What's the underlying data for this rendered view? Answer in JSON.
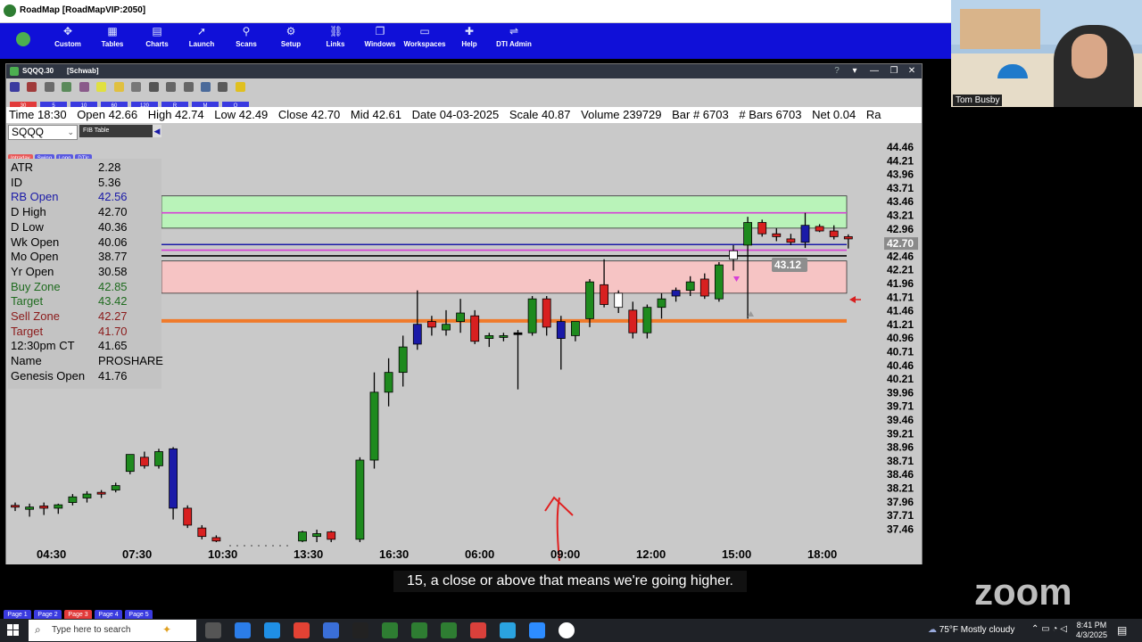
{
  "app": {
    "title": "RoadMap [RoadMapVIP:2050]"
  },
  "ribbon": {
    "items": [
      {
        "label": "Custom",
        "icon": "custom-icon"
      },
      {
        "label": "Tables",
        "icon": "tables-icon"
      },
      {
        "label": "Charts",
        "icon": "charts-icon"
      },
      {
        "label": "Launch",
        "icon": "launch-icon"
      },
      {
        "label": "Scans",
        "icon": "scans-icon"
      },
      {
        "label": "Setup",
        "icon": "gear-icon"
      },
      {
        "label": "Links",
        "icon": "links-icon"
      },
      {
        "label": "Windows",
        "icon": "windows-icon"
      },
      {
        "label": "Workspaces",
        "icon": "workspaces-icon"
      },
      {
        "label": "Help",
        "icon": "help-icon"
      },
      {
        "label": "DTI Admin",
        "icon": "admin-icon"
      }
    ]
  },
  "chart_window": {
    "title_symbol": "SQQQ.30",
    "title_source": "[Schwab]",
    "intervals": [
      {
        "label": "30",
        "active": true
      },
      {
        "label": "5",
        "active": false
      },
      {
        "label": "10",
        "active": false
      },
      {
        "label": "60",
        "active": false
      },
      {
        "label": "120",
        "active": false
      },
      {
        "label": "R",
        "active": false
      },
      {
        "label": "M",
        "active": false
      },
      {
        "label": "Q",
        "active": false
      }
    ],
    "info_bar": {
      "time": "Time 18:30",
      "open": "Open 42.66",
      "high": "High 42.74",
      "low": "Low 42.49",
      "close": "Close 42.70",
      "mid": "Mid 42.61",
      "date": "Date 04-03-2025",
      "scale": "Scale 40.87",
      "volume": "Volume 239729",
      "bar": "Bar # 6703",
      "bars": "# Bars 6703",
      "net": "Net 0.04",
      "range": "Ra"
    },
    "symbol_input": "SQQQ",
    "options": "FIB  Table",
    "panel_tabs": [
      {
        "label": "Intraday",
        "active": true
      },
      {
        "label": "Swing",
        "active": false
      },
      {
        "label": "Long",
        "active": false
      },
      {
        "label": "DTIc",
        "active": false
      }
    ],
    "stats": [
      {
        "key": "ATR",
        "value": "2.28",
        "color": "#000000"
      },
      {
        "key": "ID",
        "value": "5.36",
        "color": "#000000"
      },
      {
        "key": "RB Open",
        "value": "42.56",
        "color": "#1a1aa8"
      },
      {
        "key": "D High",
        "value": "42.70",
        "color": "#000000"
      },
      {
        "key": "D Low",
        "value": "40.36",
        "color": "#000000"
      },
      {
        "key": "Wk Open",
        "value": "40.06",
        "color": "#000000"
      },
      {
        "key": "Mo Open",
        "value": "38.77",
        "color": "#000000"
      },
      {
        "key": "Yr Open",
        "value": "30.58",
        "color": "#000000"
      },
      {
        "key": "Buy Zone",
        "value": "42.85",
        "color": "#1f6b1f"
      },
      {
        "key": "Target",
        "value": "43.42",
        "color": "#1f6b1f"
      },
      {
        "key": "Sell Zone",
        "value": "42.27",
        "color": "#8b1a1a"
      },
      {
        "key": "Target",
        "value": "41.70",
        "color": "#8b1a1a"
      },
      {
        "key": "12:30pm CT",
        "value": "41.65",
        "color": "#000000"
      },
      {
        "key": "Name",
        "value": "PROSHARE",
        "color": "#000000"
      },
      {
        "key": "Genesis Open",
        "value": "41.76",
        "color": "#000000"
      }
    ]
  },
  "chart_data": {
    "type": "candlestick",
    "symbol": "SQQQ",
    "interval": "30",
    "y_ticks": [
      "44.46",
      "44.21",
      "43.96",
      "43.71",
      "43.46",
      "43.21",
      "42.96",
      "42.70",
      "42.46",
      "42.21",
      "41.96",
      "41.71",
      "41.46",
      "41.21",
      "40.96",
      "40.71",
      "40.46",
      "40.21",
      "39.96",
      "39.71",
      "39.46",
      "39.21",
      "38.96",
      "38.71",
      "38.46",
      "38.21",
      "37.96",
      "37.71",
      "37.46"
    ],
    "x_ticks": [
      "04:30",
      "07:30",
      "10:30",
      "13:30",
      "16:30",
      "06:00",
      "09:00",
      "12:00",
      "15:00",
      "18:00"
    ],
    "ylim": [
      37.3,
      44.55
    ],
    "current_price": "42.70",
    "marker_label": "43.12",
    "zones": [
      {
        "name": "Buy Zone",
        "low": 42.85,
        "high": 43.42,
        "color": "#b9f3b9"
      },
      {
        "name": "Sell Zone",
        "low": 41.7,
        "high": 42.27,
        "color": "#f6c4c4"
      }
    ],
    "levels": [
      {
        "value": 43.12,
        "color": "#d63fd6"
      },
      {
        "value": 42.56,
        "color": "#1a1aa8"
      },
      {
        "value": 42.46,
        "color": "#d63fd6"
      },
      {
        "value": 42.36,
        "color": "#000000"
      },
      {
        "value": 41.21,
        "color": "#f07a2a"
      }
    ],
    "candles": [
      {
        "x": 0,
        "o": 37.92,
        "h": 38.0,
        "l": 37.85,
        "c": 37.95,
        "color": "red"
      },
      {
        "x": 1,
        "o": 37.88,
        "h": 37.98,
        "l": 37.75,
        "c": 37.92,
        "color": "green"
      },
      {
        "x": 2,
        "o": 37.9,
        "h": 38.0,
        "l": 37.78,
        "c": 37.94,
        "color": "red"
      },
      {
        "x": 3,
        "o": 37.9,
        "h": 37.98,
        "l": 37.8,
        "c": 37.96,
        "color": "green"
      },
      {
        "x": 4,
        "o": 38.0,
        "h": 38.15,
        "l": 37.95,
        "c": 38.1,
        "color": "green"
      },
      {
        "x": 5,
        "o": 38.08,
        "h": 38.2,
        "l": 38.0,
        "c": 38.15,
        "color": "green"
      },
      {
        "x": 6,
        "o": 38.15,
        "h": 38.22,
        "l": 38.08,
        "c": 38.18,
        "color": "red"
      },
      {
        "x": 7,
        "o": 38.22,
        "h": 38.35,
        "l": 38.18,
        "c": 38.3,
        "color": "green"
      },
      {
        "x": 8,
        "o": 38.55,
        "h": 38.85,
        "l": 38.5,
        "c": 38.85,
        "color": "green"
      },
      {
        "x": 9,
        "o": 38.8,
        "h": 38.9,
        "l": 38.6,
        "c": 38.65,
        "color": "red"
      },
      {
        "x": 10,
        "o": 38.65,
        "h": 38.95,
        "l": 38.6,
        "c": 38.9,
        "color": "green"
      },
      {
        "x": 11,
        "o": 38.95,
        "h": 38.98,
        "l": 37.7,
        "c": 37.9,
        "color": "blue"
      },
      {
        "x": 12,
        "o": 37.9,
        "h": 37.95,
        "l": 37.55,
        "c": 37.6,
        "color": "red"
      },
      {
        "x": 13,
        "o": 37.55,
        "h": 37.6,
        "l": 37.35,
        "c": 37.4,
        "color": "red"
      },
      {
        "x": 14,
        "o": 37.38,
        "h": 37.42,
        "l": 37.3,
        "c": 37.32,
        "color": "red"
      },
      {
        "x": 20,
        "o": 37.32,
        "h": 37.5,
        "l": 37.3,
        "c": 37.48,
        "color": "green"
      },
      {
        "x": 21,
        "o": 37.4,
        "h": 37.52,
        "l": 37.3,
        "c": 37.45,
        "color": "green"
      },
      {
        "x": 22,
        "o": 37.48,
        "h": 37.5,
        "l": 37.3,
        "c": 37.35,
        "color": "red"
      },
      {
        "x": 24,
        "o": 37.35,
        "h": 38.8,
        "l": 37.3,
        "c": 38.75,
        "color": "green"
      },
      {
        "x": 25,
        "o": 38.75,
        "h": 40.3,
        "l": 38.6,
        "c": 39.95,
        "color": "green"
      },
      {
        "x": 26,
        "o": 39.95,
        "h": 40.55,
        "l": 39.7,
        "c": 40.3,
        "color": "green"
      },
      {
        "x": 27,
        "o": 40.3,
        "h": 40.95,
        "l": 40.05,
        "c": 40.75,
        "color": "green"
      },
      {
        "x": 28,
        "o": 40.8,
        "h": 41.75,
        "l": 40.7,
        "c": 41.15,
        "color": "blue"
      },
      {
        "x": 29,
        "o": 41.1,
        "h": 41.3,
        "l": 40.95,
        "c": 41.2,
        "color": "red"
      },
      {
        "x": 30,
        "o": 41.05,
        "h": 41.4,
        "l": 40.95,
        "c": 41.15,
        "color": "green"
      },
      {
        "x": 31,
        "o": 41.2,
        "h": 41.6,
        "l": 41.0,
        "c": 41.35,
        "color": "green"
      },
      {
        "x": 32,
        "o": 41.3,
        "h": 41.4,
        "l": 40.8,
        "c": 40.85,
        "color": "red"
      },
      {
        "x": 33,
        "o": 40.9,
        "h": 41.0,
        "l": 40.75,
        "c": 40.95,
        "color": "green"
      },
      {
        "x": 34,
        "o": 40.93,
        "h": 41.0,
        "l": 40.85,
        "c": 40.95,
        "color": "green"
      },
      {
        "x": 35,
        "o": 41.0,
        "h": 41.05,
        "l": 40.0,
        "c": 41.0,
        "color": "black"
      },
      {
        "x": 36,
        "o": 41.0,
        "h": 41.65,
        "l": 40.95,
        "c": 41.6,
        "color": "green"
      },
      {
        "x": 37,
        "o": 41.6,
        "h": 41.65,
        "l": 40.95,
        "c": 41.1,
        "color": "red"
      },
      {
        "x": 38,
        "o": 40.9,
        "h": 41.3,
        "l": 40.35,
        "c": 41.2,
        "color": "blue"
      },
      {
        "x": 39,
        "o": 40.95,
        "h": 41.2,
        "l": 40.85,
        "c": 41.2,
        "color": "green"
      },
      {
        "x": 40,
        "o": 41.25,
        "h": 41.95,
        "l": 41.1,
        "c": 41.9,
        "color": "green"
      },
      {
        "x": 41,
        "o": 41.85,
        "h": 42.3,
        "l": 41.45,
        "c": 41.5,
        "color": "red"
      },
      {
        "x": 42,
        "o": 41.45,
        "h": 41.75,
        "l": 41.35,
        "c": 41.7,
        "color": "white"
      },
      {
        "x": 43,
        "o": 41.4,
        "h": 41.55,
        "l": 40.9,
        "c": 41.0,
        "color": "red"
      },
      {
        "x": 44,
        "o": 41.0,
        "h": 41.5,
        "l": 40.9,
        "c": 41.45,
        "color": "green"
      },
      {
        "x": 45,
        "o": 41.45,
        "h": 41.7,
        "l": 41.25,
        "c": 41.6,
        "color": "green"
      },
      {
        "x": 46,
        "o": 41.65,
        "h": 41.8,
        "l": 41.55,
        "c": 41.75,
        "color": "blue"
      },
      {
        "x": 47,
        "o": 41.75,
        "h": 42.0,
        "l": 41.65,
        "c": 41.9,
        "color": "green"
      },
      {
        "x": 48,
        "o": 41.95,
        "h": 42.05,
        "l": 41.6,
        "c": 41.65,
        "color": "red"
      },
      {
        "x": 49,
        "o": 41.6,
        "h": 42.25,
        "l": 41.55,
        "c": 42.2,
        "color": "green"
      },
      {
        "x": 50,
        "o": 42.3,
        "h": 42.55,
        "l": 42.1,
        "c": 42.45,
        "color": "white"
      },
      {
        "x": 51,
        "o": 42.55,
        "h": 43.05,
        "l": 41.25,
        "c": 42.95,
        "color": "green"
      },
      {
        "x": 52,
        "o": 42.95,
        "h": 43.0,
        "l": 42.7,
        "c": 42.75,
        "color": "red"
      },
      {
        "x": 53,
        "o": 42.75,
        "h": 42.85,
        "l": 42.62,
        "c": 42.7,
        "color": "red"
      },
      {
        "x": 54,
        "o": 42.66,
        "h": 42.75,
        "l": 42.55,
        "c": 42.6,
        "color": "red"
      },
      {
        "x": 55,
        "o": 42.6,
        "h": 43.12,
        "l": 42.5,
        "c": 42.9,
        "color": "blue"
      },
      {
        "x": 56,
        "o": 42.88,
        "h": 42.92,
        "l": 42.78,
        "c": 42.8,
        "color": "red"
      },
      {
        "x": 57,
        "o": 42.8,
        "h": 42.9,
        "l": 42.65,
        "c": 42.7,
        "color": "red"
      },
      {
        "x": 58,
        "o": 42.66,
        "h": 42.74,
        "l": 42.49,
        "c": 42.7,
        "color": "red"
      }
    ]
  },
  "caption": "15, a close or above that means we're going higher.",
  "zoom_logo": "zoom",
  "page_tabs": [
    {
      "label": "Page 1",
      "active": false
    },
    {
      "label": "Page 2",
      "active": false
    },
    {
      "label": "Page 3",
      "active": true
    },
    {
      "label": "Page 4",
      "active": false
    },
    {
      "label": "Page 5",
      "active": false
    }
  ],
  "webcam": {
    "name": "Tom Busby"
  },
  "taskbar": {
    "search_placeholder": "Type here to search",
    "weather": "75°F  Mostly cloudy",
    "time": "8:41 PM",
    "date": "4/3/2025",
    "icons": [
      "task-view-icon",
      "copilot-icon",
      "edge-icon",
      "chrome-icon",
      "calculator-icon",
      "tradingview-icon",
      "app-icon",
      "app-icon",
      "roadmap-icon",
      "app-icon",
      "telegram-icon",
      "zoom-app-icon",
      "media-icon"
    ]
  }
}
